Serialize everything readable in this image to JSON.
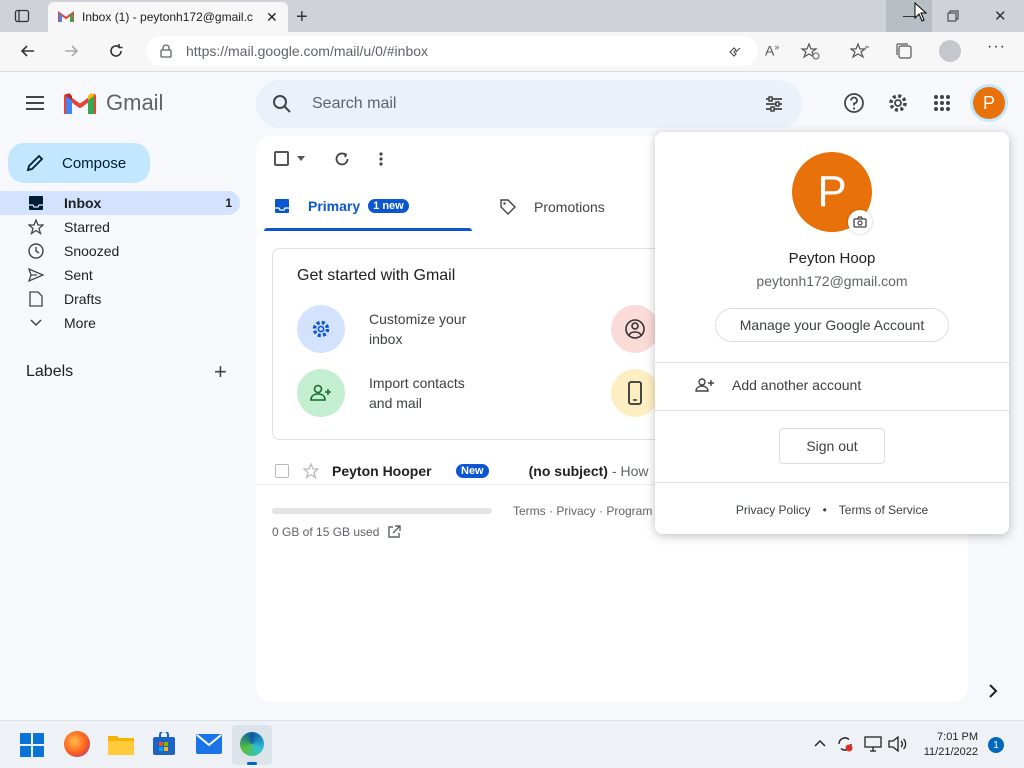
{
  "browser": {
    "tab_title": "Inbox (1) - peytonh172@gmail.c",
    "url": "https://mail.google.com/mail/u/0/#inbox"
  },
  "gmail": {
    "logo_text": "Gmail",
    "search_placeholder": "Search mail",
    "avatar_letter": "P",
    "compose_label": "Compose"
  },
  "sidebar": {
    "items": [
      {
        "label": "Inbox",
        "icon": "inbox-icon",
        "count": "1"
      },
      {
        "label": "Starred",
        "icon": "star-icon"
      },
      {
        "label": "Snoozed",
        "icon": "clock-icon"
      },
      {
        "label": "Sent",
        "icon": "send-icon"
      },
      {
        "label": "Drafts",
        "icon": "draft-icon"
      },
      {
        "label": "More",
        "icon": "chevron-down-icon"
      }
    ],
    "labels_heading": "Labels"
  },
  "tabs": [
    {
      "label": "Primary",
      "badge": "1 new"
    },
    {
      "label": "Promotions"
    }
  ],
  "get_started": {
    "title": "Get started with Gmail",
    "items": [
      {
        "text": "Customize your inbox",
        "icon": "gear-icon"
      },
      {
        "text": "Import contacts and mail",
        "icon": "add-contact-icon"
      }
    ]
  },
  "mail_row": {
    "sender": "Peyton Hooper",
    "badge": "New",
    "subject": "(no subject)",
    "snippet": "- How"
  },
  "footer": {
    "links": "Terms · Privacy · Program",
    "storage": "0 GB of 15 GB used"
  },
  "account_popup": {
    "avatar_letter": "P",
    "name": "Peyton Hoop",
    "email": "peytonh172@gmail.com",
    "manage_label": "Manage your Google Account",
    "add_account_label": "Add another account",
    "sign_out_label": "Sign out",
    "privacy_label": "Privacy Policy",
    "bullet": "•",
    "terms_label": "Terms of Service"
  },
  "taskbar": {
    "time": "7:01 PM",
    "date": "11/21/2022",
    "notification_count": "1"
  },
  "colors": {
    "accent": "#0b57d0",
    "avatar": "#e8710a",
    "compose_bg": "#c2e7ff",
    "active_nav": "#d3e3fd"
  }
}
